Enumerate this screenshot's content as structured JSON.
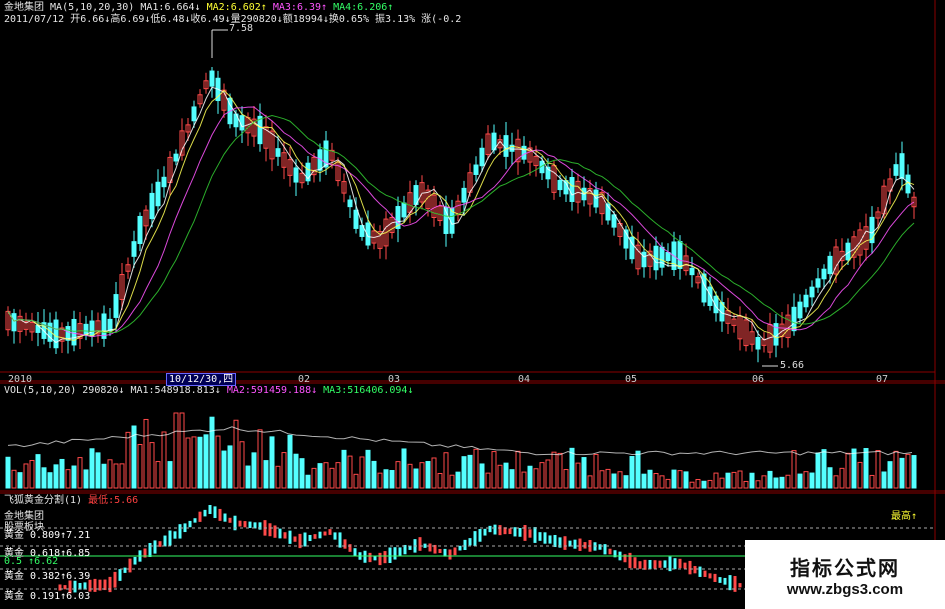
{
  "header": {
    "stock_name": "金地集团",
    "ma_label": "MA(5,10,20,30)",
    "ma1": "MA1:6.664↓",
    "ma2": "MA2:6.602↑",
    "ma3": "MA3:6.39↑",
    "ma4": "MA4:6.206↑",
    "quote": "2011/07/12 开6.66↓高6.69↓低6.48↓收6.49↓量290820↓额18994↓换0.65% 振3.13% 涨(-0.2"
  },
  "price_panel": {
    "high_marker": "7.58",
    "low_marker": "5.66",
    "date_box": "10/12/30,四",
    "x_labels": [
      "2010",
      "02",
      "03",
      "04",
      "05",
      "06",
      "07"
    ]
  },
  "volume_panel": {
    "title": "VOL(5,10,20)",
    "value": "290820↓",
    "ma1": "MA1:548918.813↓",
    "ma2": "MA2:591459.188↓",
    "ma3": "MA3:516406.094↓"
  },
  "gold_panel": {
    "title": "飞狐黄金分割(1)",
    "low_label": "最低:5.66",
    "name": "金地集团",
    "subtitle": "股票板块",
    "high_tag": "最高↑",
    "levels": [
      {
        "text": "黄金 0.809↑7.21",
        "color": "#ffffff"
      },
      {
        "text": "黄金 0.618↑6.85",
        "color": "#ffffff"
      },
      {
        "text": "0.5   ↑6.62",
        "color": "#33ff66"
      },
      {
        "text": "黄金 0.382↑6.39",
        "color": "#ffffff"
      },
      {
        "text": "黄金 0.191↑6.03",
        "color": "#ffffff"
      }
    ]
  },
  "watermark": {
    "line1": "指标公式网",
    "line2": "www.zbgs3.com"
  },
  "colors": {
    "up": "#ff4a4a",
    "down": "#54ffff",
    "ma5": "#ffffff",
    "ma10": "#ffff55",
    "ma20": "#ff55ff",
    "ma30": "#33cc33",
    "grid": "#7a0000"
  },
  "chart_data": {
    "type": "candlestick",
    "price_range": [
      5.66,
      7.58
    ],
    "note_levels": [
      7.21,
      6.85,
      6.62,
      6.39,
      6.03
    ]
  }
}
